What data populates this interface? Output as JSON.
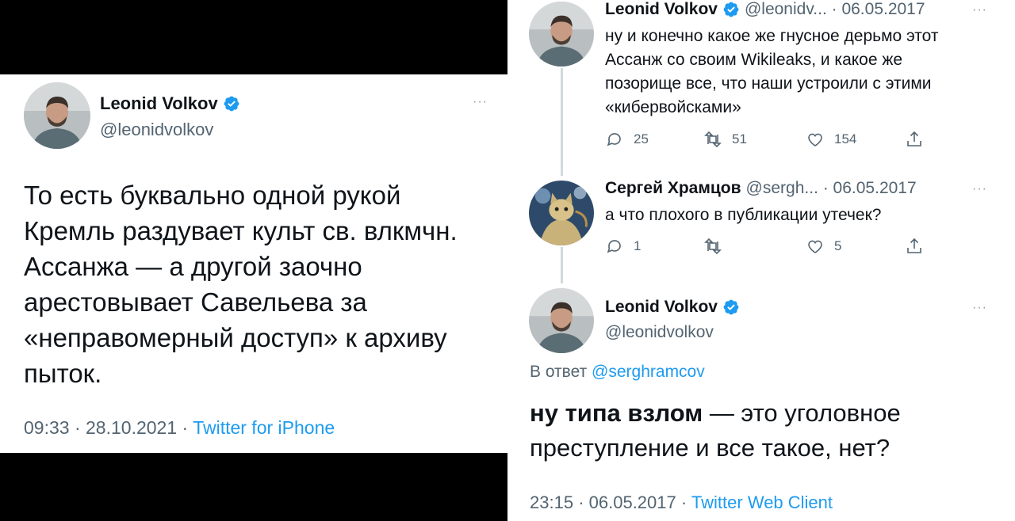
{
  "left_tweet": {
    "author_name": "Leonid Volkov",
    "handle": "@leonidvolkov",
    "more": "···",
    "text": "То есть буквально одной рукой Кремль раздувает культ св. влкмчн. Ассанжа — а другой заочно арестовывает Савельева за «неправомерный доступ» к архиву пыток.",
    "time": "09:33",
    "date": "28.10.2021",
    "separator": "·",
    "source": "Twitter for iPhone"
  },
  "thread": [
    {
      "author_name": "Leonid Volkov",
      "handle_date": "@leonidv... · 06.05.2017",
      "more": "···",
      "text": "ну и конечно какое же гнусное дерьмо этот Ассанж со своим Wikileaks, и какое же позорище все, что наши устроили с этими «кибервойсками»",
      "replies": "25",
      "retweets": "51",
      "likes": "154"
    },
    {
      "author_name": "Сергей Храмцов",
      "handle_date": "@sergh... · 06.05.2017",
      "more": "···",
      "text": "а что плохого в публикации утечек?",
      "replies": "1",
      "retweets": "",
      "likes": "5"
    }
  ],
  "focused_tweet": {
    "author_name": "Leonid Volkov",
    "handle": "@leonidvolkov",
    "more": "···",
    "reply_prefix": "В ответ",
    "reply_handle": "@serghramcov",
    "text_bold": "ну типа взлом",
    "text_rest": " — это уголовное преступление и все такое, нет?",
    "time": "23:15",
    "date": "06.05.2017",
    "separator": "·",
    "source": "Twitter Web Client"
  },
  "colors": {
    "link": "#1d9bf0",
    "secondary_text": "#536471",
    "primary_text": "#0f1419",
    "verified_badge": "#1d9bf0",
    "background_left": "#000000"
  },
  "icons": [
    "verified-badge-icon",
    "reply-icon",
    "retweet-icon",
    "like-icon",
    "share-icon",
    "more-icon"
  ]
}
